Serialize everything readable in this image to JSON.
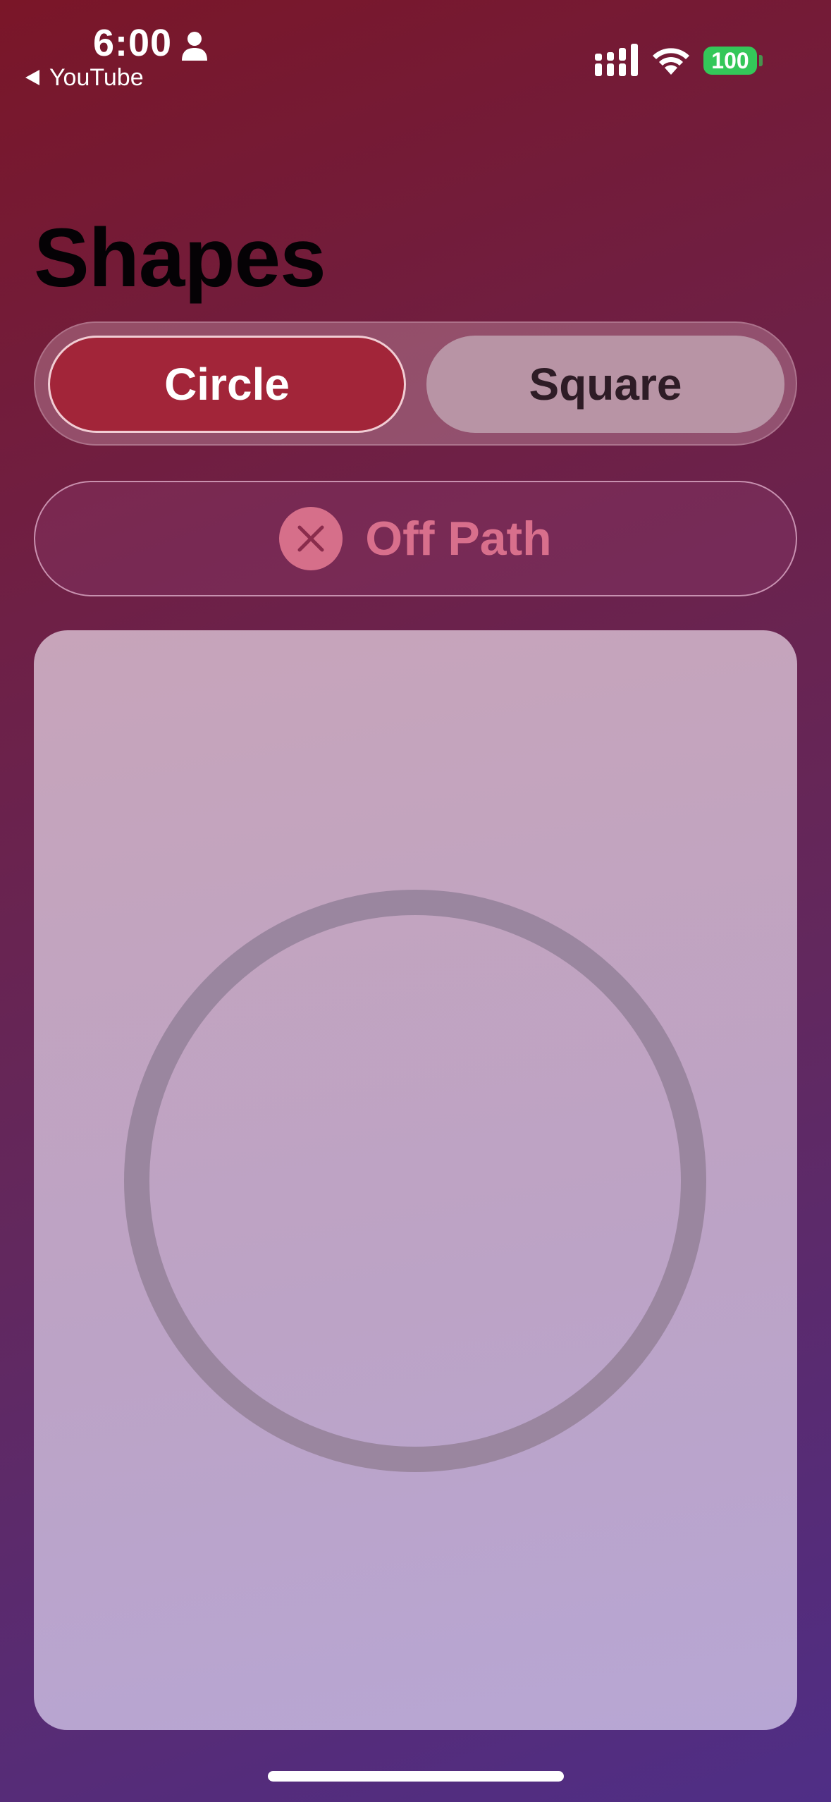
{
  "status_bar": {
    "time": "6:00",
    "back_app": "YouTube",
    "battery": "100",
    "icons": [
      "person-icon",
      "signal-icon",
      "wifi-icon",
      "battery-icon"
    ]
  },
  "page": {
    "title": "Shapes"
  },
  "segmented_control": {
    "options": [
      {
        "label": "Circle",
        "selected": true
      },
      {
        "label": "Square",
        "selected": false
      }
    ]
  },
  "path_status": {
    "icon": "close-icon",
    "label": "Off Path"
  },
  "canvas": {
    "shape": "circle"
  },
  "colors": {
    "accent": "#a22539",
    "off_path": "#d86f8c",
    "battery": "#34c759",
    "shape_stroke": "#9a869f"
  }
}
